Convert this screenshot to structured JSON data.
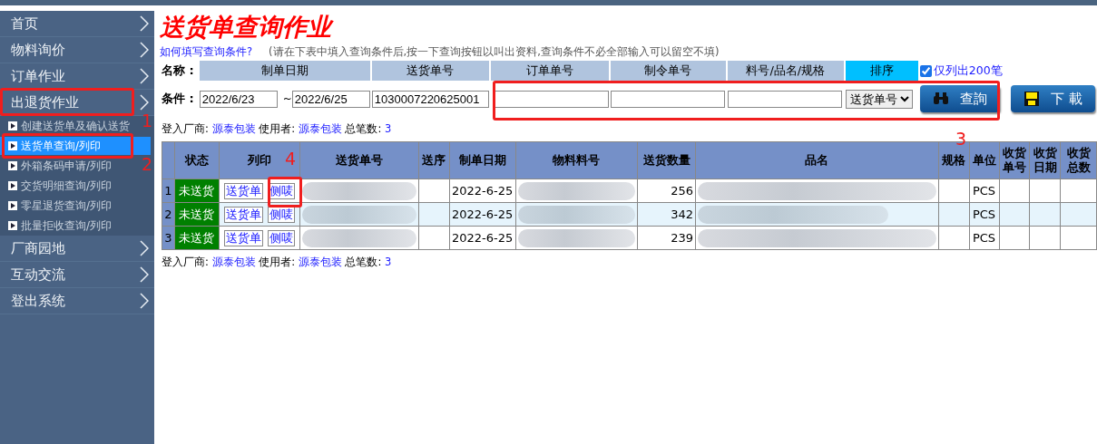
{
  "sidebar": {
    "items": [
      {
        "label": "首页"
      },
      {
        "label": "物料询价"
      },
      {
        "label": "订单作业"
      },
      {
        "label": "出退货作业",
        "children": [
          {
            "label": "创建送货单及确认送货",
            "selected": false
          },
          {
            "label": "送货单查询/列印",
            "selected": true
          },
          {
            "label": "外箱条码申请/列印",
            "selected": false
          },
          {
            "label": "交货明细查询/列印",
            "selected": false
          },
          {
            "label": "零星退货查询/列印",
            "selected": false
          },
          {
            "label": "批量拒收查询/列印",
            "selected": false
          }
        ]
      },
      {
        "label": "厂商园地"
      },
      {
        "label": "互动交流"
      },
      {
        "label": "登出系统"
      }
    ]
  },
  "page_title": "送货单查询作业",
  "help_link": "如何填写查询条件?",
  "hint": "(请在下表中填入查询条件后,按一下查询按钮以叫出资料,查询条件不必全部输入可以留空不填)",
  "query": {
    "name_label": "名称 :",
    "condition_label": "条件 :",
    "headers": [
      {
        "label": "制单日期",
        "kind": "field"
      },
      {
        "label": "送货单号",
        "kind": "field"
      },
      {
        "label": "订单单号",
        "kind": "field"
      },
      {
        "label": "制令单号",
        "kind": "field"
      },
      {
        "label": "料号/品名/规格",
        "kind": "field"
      },
      {
        "label": "排序",
        "kind": "sort"
      }
    ],
    "limit": {
      "label": "仅列出200笔",
      "checked": true
    },
    "date_from": "2022/6/23",
    "range_mark": "~",
    "date_to": "2022/6/25",
    "delivery_no": "1030007220625001",
    "sort_value": "送货单号",
    "buttons": [
      {
        "label": "查詢",
        "kind": "search"
      },
      {
        "label": "下 載",
        "kind": "download"
      }
    ]
  },
  "login_info": [
    {
      "vendor_label": "登入厂商:",
      "vendor": "源泰包装",
      "user_label": "使用者:",
      "user": "源泰包装",
      "total_label": "总笔数:",
      "total": "3"
    },
    {
      "vendor_label": "登入厂商:",
      "vendor": "源泰包装",
      "user_label": "使用者:",
      "user": "源泰包装",
      "total_label": "总笔数:",
      "total": "3"
    }
  ],
  "table": {
    "columns": [
      "状态",
      "列印",
      "送货单号",
      "送序",
      "制单日期",
      "物料料号",
      "送货数量",
      "品名",
      "规格",
      "单位",
      "收货单号",
      "收货日期",
      "收货总数"
    ],
    "rows": [
      {
        "index": "1",
        "status": "未送货",
        "links": [
          "送货单",
          "侧唛"
        ],
        "date": "2022-6-25",
        "qty": "256",
        "unit": "PCS",
        "highlighted": false
      },
      {
        "index": "2",
        "status": "未送货",
        "links": [
          "送货单",
          "侧唛"
        ],
        "date": "2022-6-25",
        "qty": "342",
        "unit": "PCS",
        "highlighted": true
      },
      {
        "index": "3",
        "status": "未送货",
        "links": [
          "送货单",
          "侧唛"
        ],
        "date": "2022-6-25",
        "qty": "239",
        "unit": "PCS",
        "highlighted": false
      }
    ]
  },
  "annotations": [
    {
      "label": "1"
    },
    {
      "label": "2"
    },
    {
      "label": "3"
    },
    {
      "label": "4"
    }
  ]
}
